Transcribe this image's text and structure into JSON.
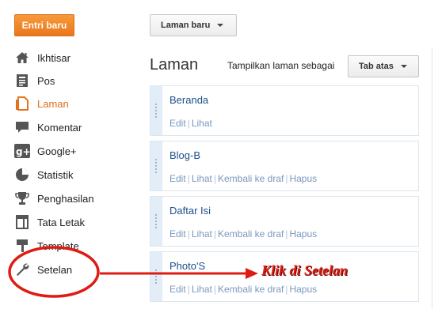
{
  "toolbar": {
    "new_post_label": "Entri baru",
    "new_page_label": "Laman baru"
  },
  "sidebar": {
    "items": [
      {
        "label": "Ikhtisar",
        "icon": "home-icon"
      },
      {
        "label": "Pos",
        "icon": "posts-icon"
      },
      {
        "label": "Laman",
        "icon": "pages-icon",
        "active": true
      },
      {
        "label": "Komentar",
        "icon": "comment-icon"
      },
      {
        "label": "Google+",
        "icon": "google-plus-icon"
      },
      {
        "label": "Statistik",
        "icon": "stats-icon"
      },
      {
        "label": "Penghasilan",
        "icon": "trophy-icon"
      },
      {
        "label": "Tata Letak",
        "icon": "layout-icon"
      },
      {
        "label": "Template",
        "icon": "template-icon"
      },
      {
        "label": "Setelan",
        "icon": "wrench-icon"
      }
    ]
  },
  "main": {
    "title": "Laman",
    "display_label": "Tampilkan laman sebagai",
    "display_value": "Tab atas",
    "pages": [
      {
        "name": "Beranda",
        "actions": [
          "Edit",
          "Lihat"
        ]
      },
      {
        "name": "Blog-B",
        "actions": [
          "Edit",
          "Lihat",
          "Kembali ke draf",
          "Hapus"
        ]
      },
      {
        "name": "Daftar Isi",
        "actions": [
          "Edit",
          "Lihat",
          "Kembali ke draf",
          "Hapus"
        ]
      },
      {
        "name": "Photo'S",
        "actions": [
          "Edit",
          "Lihat",
          "Kembali ke draf",
          "Hapus"
        ]
      }
    ]
  },
  "annotation": {
    "text": "Klik di Setelan",
    "color": "#e01b12"
  },
  "colors": {
    "accent": "#f08a2a",
    "active_nav": "#dd6d1a",
    "link": "#1c4f8c"
  }
}
